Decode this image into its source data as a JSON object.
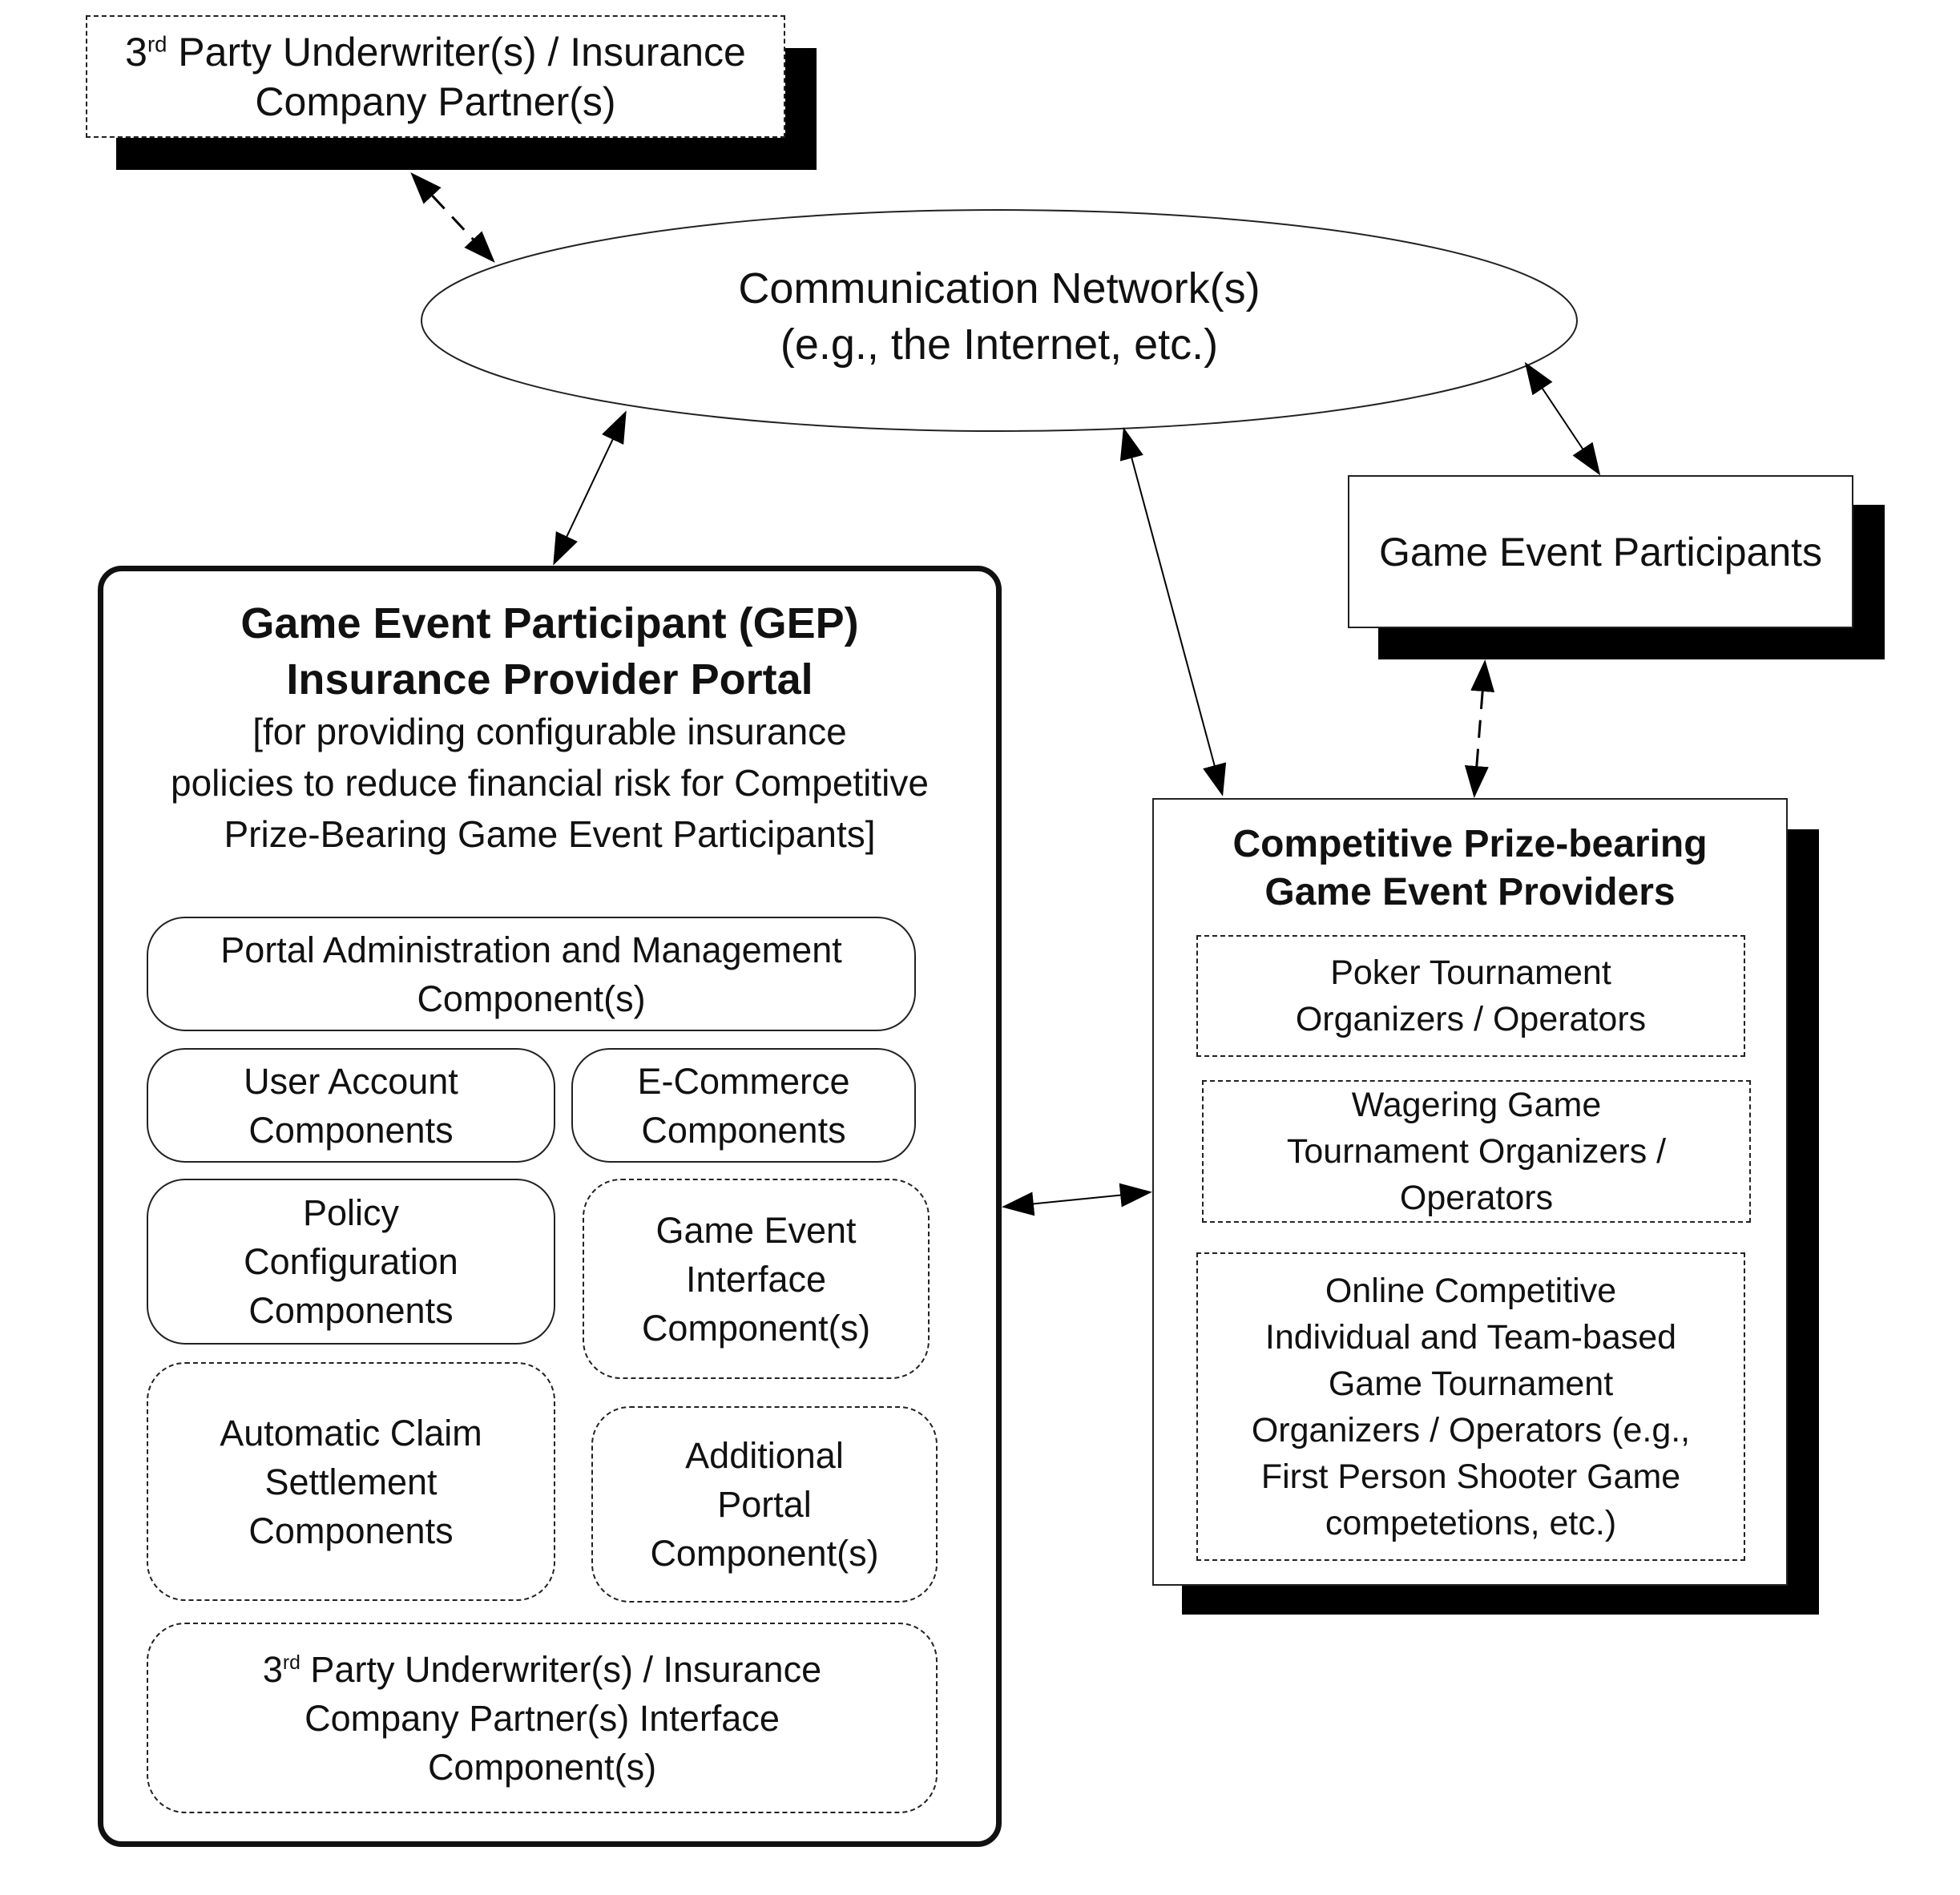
{
  "underwriter_box": {
    "line1_prefix": "3",
    "line1_sup": "rd",
    "line1_rest": " Party Underwriter(s) / Insurance",
    "line2": "Company Partner(s)"
  },
  "network": {
    "line1": "Communication Network(s)",
    "line2": "(e.g., the Internet, etc.)"
  },
  "participants_box": {
    "label": "Game Event Participants"
  },
  "portal": {
    "title_line1": "Game Event Participant (GEP)",
    "title_line2": "Insurance Provider Portal",
    "desc_line1": "[for providing configurable insurance",
    "desc_line2": "policies to reduce financial risk for Competitive",
    "desc_line3": "Prize-Bearing Game Event Participants]",
    "components": {
      "admin": [
        "Portal Administration and Management",
        "Component(s)"
      ],
      "user_account": [
        "User Account",
        "Components"
      ],
      "ecommerce": [
        "E-Commerce",
        "Components"
      ],
      "policy": [
        "Policy",
        "Configuration",
        "Components"
      ],
      "game_event_interface": [
        "Game Event",
        "Interface",
        "Component(s)"
      ],
      "claim_settlement": [
        "Automatic Claim",
        "Settlement",
        "Components"
      ],
      "additional": [
        "Additional",
        "Portal",
        "Component(s)"
      ],
      "underwriter_interface": {
        "line1_prefix": "3",
        "line1_sup": "rd",
        "line1_rest": " Party Underwriter(s) / Insurance",
        "line2": "Company Partner(s) Interface",
        "line3": "Component(s)"
      }
    }
  },
  "providers": {
    "title_line1": "Competitive Prize-bearing",
    "title_line2": "Game Event Providers",
    "items": [
      [
        "Poker Tournament",
        "Organizers / Operators"
      ],
      [
        "Wagering Game",
        "Tournament Organizers /",
        "Operators"
      ],
      [
        "Online Competitive",
        "Individual and Team-based",
        "Game Tournament",
        "Organizers / Operators (e.g.,",
        "First Person Shooter Game",
        "competetions, etc.)"
      ]
    ]
  }
}
